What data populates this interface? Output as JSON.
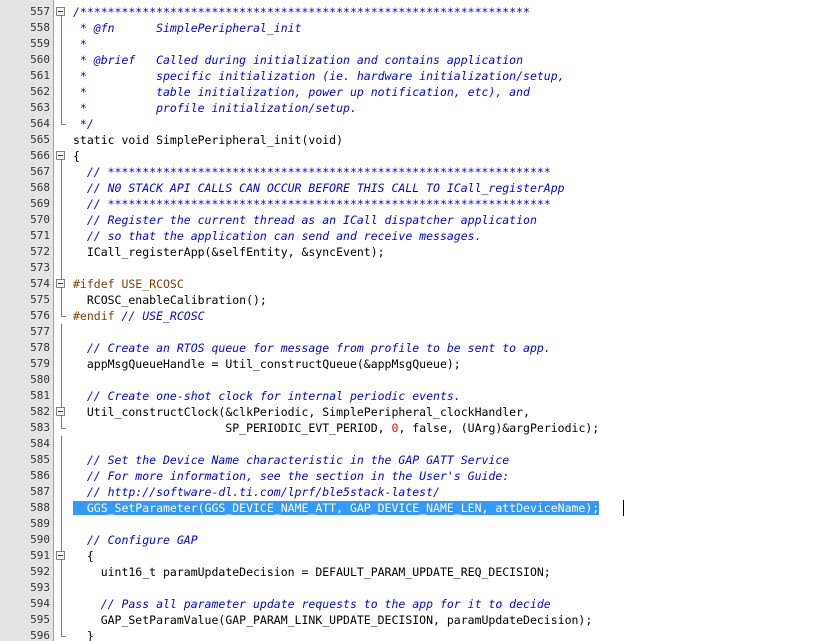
{
  "editor": {
    "lines": [
      {
        "n": "557",
        "fold": "box",
        "segments": [
          {
            "t": "/*****************************************************************",
            "c": "cm"
          }
        ]
      },
      {
        "n": "558",
        "fold": "line",
        "segments": [
          {
            "t": " * @fn      SimplePeripheral_init",
            "c": "cm"
          }
        ]
      },
      {
        "n": "559",
        "fold": "line",
        "segments": [
          {
            "t": " *",
            "c": "cm"
          }
        ]
      },
      {
        "n": "560",
        "fold": "line",
        "segments": [
          {
            "t": " * @brief   Called during initialization and contains application",
            "c": "cm"
          }
        ]
      },
      {
        "n": "561",
        "fold": "line",
        "segments": [
          {
            "t": " *          specific initialization (ie. hardware initialization/setup,",
            "c": "cm"
          }
        ]
      },
      {
        "n": "562",
        "fold": "line",
        "segments": [
          {
            "t": " *          table initialization, power up notification, etc), and",
            "c": "cm"
          }
        ]
      },
      {
        "n": "563",
        "fold": "line",
        "segments": [
          {
            "t": " *          profile initialization/setup.",
            "c": "cm"
          }
        ]
      },
      {
        "n": "564",
        "fold": "end",
        "segments": [
          {
            "t": " */",
            "c": "cm"
          }
        ]
      },
      {
        "n": "565",
        "fold": "none",
        "segments": [
          {
            "t": "static void SimplePeripheral_init(void)",
            "c": ""
          }
        ]
      },
      {
        "n": "566",
        "fold": "box",
        "segments": [
          {
            "t": "{",
            "c": ""
          }
        ]
      },
      {
        "n": "567",
        "fold": "line",
        "segments": [
          {
            "t": "  // ****************************************************************",
            "c": "cm"
          }
        ]
      },
      {
        "n": "568",
        "fold": "line",
        "segments": [
          {
            "t": "  // N0 STACK API CALLS CAN OCCUR BEFORE THIS CALL TO ICall_registerApp",
            "c": "cm"
          }
        ]
      },
      {
        "n": "569",
        "fold": "line",
        "segments": [
          {
            "t": "  // ****************************************************************",
            "c": "cm"
          }
        ]
      },
      {
        "n": "570",
        "fold": "line",
        "segments": [
          {
            "t": "  // Register the current thread as an ICall dispatcher application",
            "c": "cm"
          }
        ]
      },
      {
        "n": "571",
        "fold": "line",
        "segments": [
          {
            "t": "  // so that the application can send and receive messages.",
            "c": "cm"
          }
        ]
      },
      {
        "n": "572",
        "fold": "line",
        "segments": [
          {
            "t": "  ICall_registerApp(&selfEntity, &syncEvent);",
            "c": ""
          }
        ]
      },
      {
        "n": "573",
        "fold": "line",
        "segments": []
      },
      {
        "n": "574",
        "fold": "box",
        "segments": [
          {
            "t": "#ifdef USE_RCOSC",
            "c": "pp"
          }
        ]
      },
      {
        "n": "575",
        "fold": "line",
        "segments": [
          {
            "t": "  RCOSC_enableCalibration();",
            "c": ""
          }
        ]
      },
      {
        "n": "576",
        "fold": "end",
        "segments": [
          {
            "t": "#endif ",
            "c": "pp"
          },
          {
            "t": "// USE_RCOSC",
            "c": "cm"
          }
        ]
      },
      {
        "n": "577",
        "fold": "line",
        "segments": []
      },
      {
        "n": "578",
        "fold": "line",
        "segments": [
          {
            "t": "  // Create an RTOS queue for message from profile to be sent to app.",
            "c": "cm"
          }
        ]
      },
      {
        "n": "579",
        "fold": "line",
        "segments": [
          {
            "t": "  appMsgQueueHandle = Util_constructQueue(&appMsgQueue);",
            "c": ""
          }
        ]
      },
      {
        "n": "580",
        "fold": "line",
        "segments": []
      },
      {
        "n": "581",
        "fold": "line",
        "segments": [
          {
            "t": "  // Create one-shot clock for internal periodic events.",
            "c": "cm"
          }
        ]
      },
      {
        "n": "582",
        "fold": "box",
        "segments": [
          {
            "t": "  Util_constructClock(&clkPeriodic, SimplePeripheral_clockHandler,",
            "c": ""
          }
        ]
      },
      {
        "n": "583",
        "fold": "end",
        "segments": [
          {
            "t": "                      SP_PERIODIC_EVT_PERIOD, ",
            "c": ""
          },
          {
            "t": "0",
            "c": "num"
          },
          {
            "t": ", false, (UArg)&argPeriodic);",
            "c": ""
          }
        ]
      },
      {
        "n": "584",
        "fold": "line",
        "segments": []
      },
      {
        "n": "585",
        "fold": "line",
        "segments": [
          {
            "t": "  // Set the Device Name characteristic in the GAP GATT Service",
            "c": "cm"
          }
        ]
      },
      {
        "n": "586",
        "fold": "line",
        "segments": [
          {
            "t": "  // For more information, see the section in the User's Guide:",
            "c": "cm"
          }
        ]
      },
      {
        "n": "587",
        "fold": "line",
        "segments": [
          {
            "t": "  // http://software-dl.ti.com/lprf/ble5stack-latest/",
            "c": "cm"
          }
        ]
      },
      {
        "n": "588",
        "fold": "line",
        "segments": [
          {
            "t": "  GGS_SetParameter(GGS_DEVICE_NAME_ATT, GAP_DEVICE_NAME_LEN, attDeviceName);",
            "c": "hl"
          }
        ]
      },
      {
        "n": "589",
        "fold": "line",
        "segments": []
      },
      {
        "n": "590",
        "fold": "line",
        "segments": [
          {
            "t": "  // Configure GAP",
            "c": "cm"
          }
        ]
      },
      {
        "n": "591",
        "fold": "box",
        "segments": [
          {
            "t": "  {",
            "c": ""
          }
        ]
      },
      {
        "n": "592",
        "fold": "line",
        "segments": [
          {
            "t": "    uint16_t paramUpdateDecision = DEFAULT_PARAM_UPDATE_REQ_DECISION;",
            "c": ""
          }
        ]
      },
      {
        "n": "593",
        "fold": "line",
        "segments": []
      },
      {
        "n": "594",
        "fold": "line",
        "segments": [
          {
            "t": "    // Pass all parameter update requests to the app for it to decide",
            "c": "cm"
          }
        ]
      },
      {
        "n": "595",
        "fold": "line",
        "segments": [
          {
            "t": "    GAP_SetParamValue(GAP_PARAM_LINK_UPDATE_DECISION, paramUpdateDecision);",
            "c": ""
          }
        ]
      },
      {
        "n": "596",
        "fold": "end",
        "segments": [
          {
            "t": "  }",
            "c": ""
          }
        ]
      }
    ]
  }
}
